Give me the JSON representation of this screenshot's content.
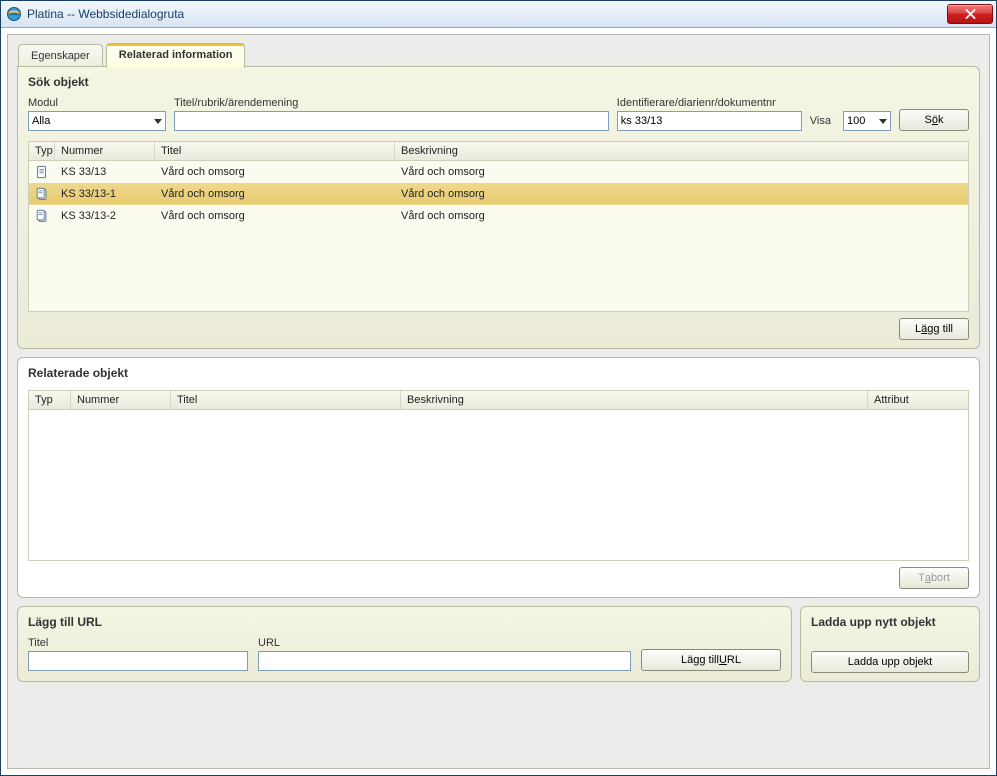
{
  "window": {
    "title": "Platina -- Webbsidedialogruta"
  },
  "tabs": {
    "properties": "Egenskaper",
    "related": "Relaterad information"
  },
  "search": {
    "panel_title": "Sök objekt",
    "module_label": "Modul",
    "module_value": "Alla",
    "title_label": "Titel/rubrik/ärendemening",
    "title_value": "",
    "identifier_label": "Identifierare/diarienr/dokumentnr",
    "identifier_value": "ks 33/13",
    "show_label": "Visa",
    "show_value": "100",
    "search_button_prefix": "S",
    "search_button_ul": "ö",
    "search_button_suffix": "k",
    "headers": {
      "type": "Typ",
      "number": "Nummer",
      "title": "Titel",
      "desc": "Beskrivning"
    },
    "rows": [
      {
        "icon": "doc",
        "number": "KS 33/13",
        "title": "Vård och omsorg",
        "desc": "Vård och omsorg",
        "selected": false
      },
      {
        "icon": "multi",
        "number": "KS 33/13-1",
        "title": "Vård och omsorg",
        "desc": "Vård och omsorg",
        "selected": true
      },
      {
        "icon": "multi",
        "number": "KS 33/13-2",
        "title": "Vård och omsorg",
        "desc": "Vård och omsorg",
        "selected": false
      }
    ],
    "add_button_prefix": "L",
    "add_button_ul": "ä",
    "add_button_suffix": "gg till"
  },
  "related": {
    "panel_title": "Relaterade objekt",
    "headers": {
      "type": "Typ",
      "number": "Nummer",
      "title": "Titel",
      "desc": "Beskrivning",
      "attr": "Attribut"
    },
    "remove_button_prefix": "T",
    "remove_button_ul": "a",
    "remove_button_suffix": " bort"
  },
  "url": {
    "panel_title": "Lägg till URL",
    "title_label": "Titel",
    "title_value": "",
    "url_label": "URL",
    "url_value": "",
    "button_prefix": "Lägg till ",
    "button_ul": "U",
    "button_suffix": "RL"
  },
  "upload": {
    "panel_title": "Ladda upp nytt objekt",
    "button_label": "Ladda upp objekt"
  }
}
